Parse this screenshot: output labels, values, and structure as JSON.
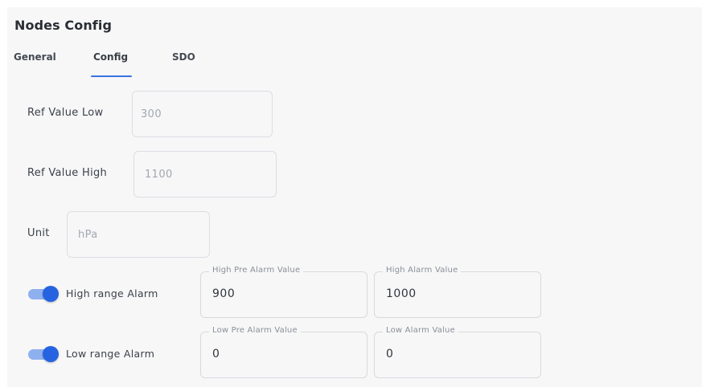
{
  "panel": {
    "title": "Nodes Config"
  },
  "tabs": [
    {
      "label": "General"
    },
    {
      "label": "Config",
      "active": true
    },
    {
      "label": "SDO"
    }
  ],
  "fields": {
    "ref_low": {
      "label": "Ref Value Low",
      "value": "300"
    },
    "ref_high": {
      "label": "Ref Value High",
      "value": "1100"
    },
    "unit": {
      "label": "Unit",
      "value": "hPa"
    }
  },
  "high_range": {
    "label": "High range Alarm",
    "enabled": true,
    "pre_alarm": {
      "label": "High Pre Alarm Value",
      "value": "900"
    },
    "alarm": {
      "label": "High Alarm Value",
      "value": "1000"
    }
  },
  "low_range": {
    "label": "Low range Alarm",
    "enabled": true,
    "pre_alarm": {
      "label": "Low Pre Alarm Value",
      "value": "0"
    },
    "alarm": {
      "label": "Low Alarm Value",
      "value": "0"
    }
  },
  "colors": {
    "accent": "#2563e0",
    "toggle_track": "#8fb0ee",
    "panel_bg": "#f7f7f8"
  }
}
